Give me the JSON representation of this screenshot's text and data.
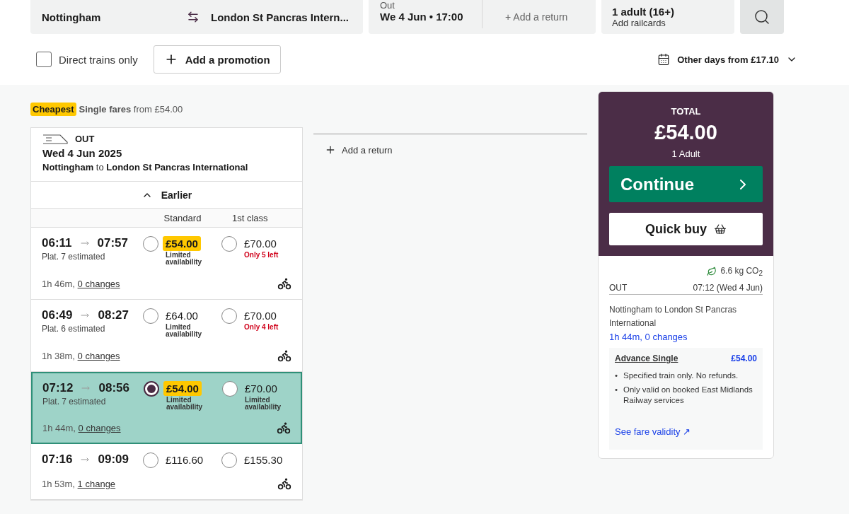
{
  "search": {
    "origin": "Nottingham",
    "destination": "London St Pancras Intern...",
    "out_label": "Out",
    "out_value": "We 4 Jun • 17:00",
    "add_return": "+ Add a return",
    "passengers": "1 adult (16+)",
    "railcards": "Add railcards"
  },
  "filters": {
    "direct_only": {
      "label": "Direct trains only",
      "checked": false
    },
    "promotion": "Add a promotion",
    "other_days": "Other days from £17.10"
  },
  "summary": {
    "badge": "Cheapest",
    "text": "**Single fares** from £54.00"
  },
  "journey": {
    "direction": "OUT",
    "date": "Wed 4 Jun 2025",
    "route": "**Nottingham** to **London St Pancras International**",
    "earlier": "Earlier",
    "columns": [
      "Standard",
      "1st class"
    ]
  },
  "trains": [
    {
      "depart": "06:11",
      "arrive": "07:57",
      "platform": "Plat. 7 estimated",
      "duration": "1h 46m, ",
      "changes": "0 changes",
      "selected": false,
      "fares": [
        {
          "price": "£54.00",
          "cheapest": true,
          "note": "Limited availability",
          "warning": false,
          "selected": false
        },
        {
          "price": "£70.00",
          "cheapest": false,
          "note": "Only 5 left",
          "warning": true,
          "selected": false
        }
      ]
    },
    {
      "depart": "06:49",
      "arrive": "08:27",
      "platform": "Plat. 6 estimated",
      "duration": "1h 38m, ",
      "changes": "0 changes",
      "selected": false,
      "fares": [
        {
          "price": "£64.00",
          "cheapest": false,
          "note": "Limited availability",
          "warning": false,
          "selected": false
        },
        {
          "price": "£70.00",
          "cheapest": false,
          "note": "Only 4 left",
          "warning": true,
          "selected": false
        }
      ]
    },
    {
      "depart": "07:12",
      "arrive": "08:56",
      "platform": "Plat. 7 estimated",
      "duration": "1h 44m, ",
      "changes": "0 changes",
      "selected": true,
      "fares": [
        {
          "price": "£54.00",
          "cheapest": true,
          "note": "Limited availability",
          "warning": false,
          "selected": true
        },
        {
          "price": "£70.00",
          "cheapest": false,
          "note": "Limited availability",
          "warning": false,
          "selected": false
        }
      ]
    },
    {
      "depart": "07:16",
      "arrive": "09:09",
      "duration": "1h 53m, ",
      "changes": "1 change",
      "selected": false,
      "fares": [
        {
          "price": "£116.60",
          "cheapest": false,
          "selected": false
        },
        {
          "price": "£155.30",
          "cheapest": false,
          "selected": false
        }
      ]
    }
  ],
  "return_link": "Add a return",
  "basket": {
    "label": "TOTAL",
    "total": "£54.00",
    "passengers": "1 Adult",
    "continue": "Continue",
    "quick_buy": "Quick buy",
    "co2": "6.6 kg CO$_{2}$",
    "direction": "OUT",
    "time": "07:12 (Wed 4 Jun)",
    "route": "Nottingham to London St Pancras International",
    "duration": "1h 44m, 0 changes",
    "ticket": "Advance Single",
    "price": "£54.00",
    "conditions": [
      {
        "bullet": "•",
        "text": "Specified train only. No refunds."
      },
      {
        "bullet": "•",
        "text": "Only valid on booked East Midlands Railway services"
      }
    ],
    "validity_link": "See fare validity ↗"
  }
}
